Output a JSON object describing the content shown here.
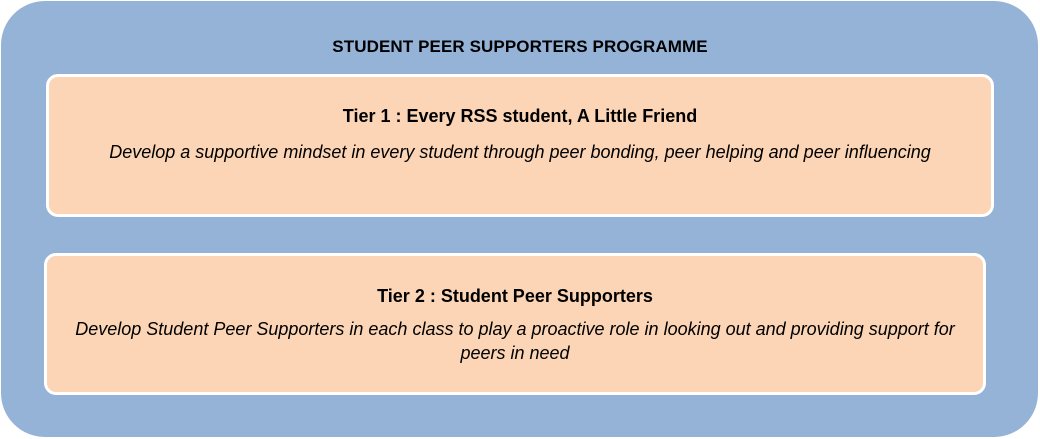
{
  "diagram": {
    "title": "STUDENT PEER SUPPORTERS PROGRAMME",
    "tiers": [
      {
        "title": "Tier 1 : Every RSS student, A Little Friend",
        "description": "Develop a supportive mindset in every student through peer bonding, peer helping and peer influencing"
      },
      {
        "title": "Tier 2 : Student Peer Supporters",
        "description": "Develop Student Peer Supporters in each class to play a proactive role in looking out and providing support for peers in need"
      }
    ]
  },
  "colors": {
    "outer_background": "#95b3d7",
    "tier_background": "#fbd5b5",
    "tier_border": "#ffffff",
    "text": "#000000"
  }
}
